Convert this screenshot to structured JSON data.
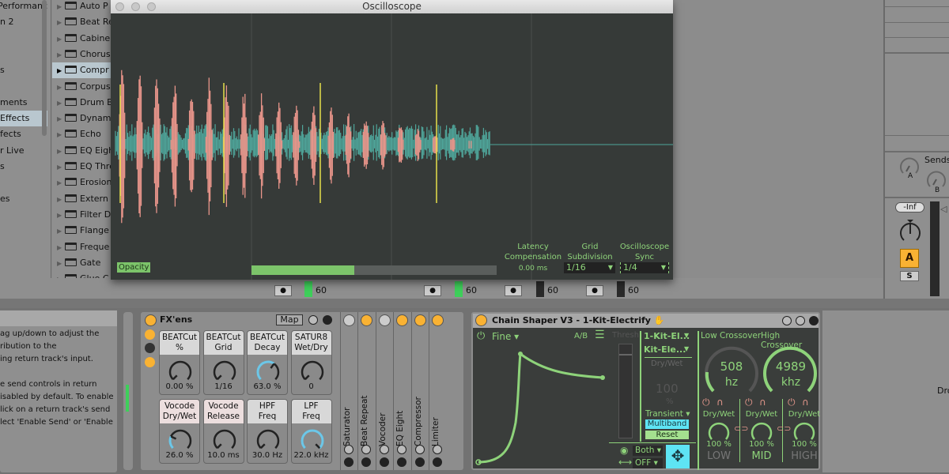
{
  "browser": {
    "categories": [
      {
        "label": "Performanc"
      },
      {
        "label": "n 2"
      },
      {
        "label": ""
      },
      {
        "label": ""
      },
      {
        "label": "s"
      },
      {
        "label": ""
      },
      {
        "label": "ments"
      },
      {
        "label": "Effects",
        "selected": true
      },
      {
        "label": "fects"
      },
      {
        "label": "r Live"
      },
      {
        "label": "s"
      },
      {
        "label": ""
      },
      {
        "label": "es"
      }
    ],
    "items": [
      {
        "label": "Auto P"
      },
      {
        "label": "Beat Re"
      },
      {
        "label": "Cabine"
      },
      {
        "label": "Chorus"
      },
      {
        "label": "Compr",
        "selected": true
      },
      {
        "label": "Corpus"
      },
      {
        "label": "Drum B"
      },
      {
        "label": "Dynam"
      },
      {
        "label": "Echo"
      },
      {
        "label": "EQ Eigh"
      },
      {
        "label": "EQ Thre"
      },
      {
        "label": "Erosion"
      },
      {
        "label": "Extern"
      },
      {
        "label": "Filter D"
      },
      {
        "label": "Flange"
      },
      {
        "label": "Freque"
      },
      {
        "label": "Gate"
      },
      {
        "label": "Glue C"
      }
    ]
  },
  "oscilloscope": {
    "title": "Oscilloscope",
    "opacity_label": "Opacity",
    "opacity_slider": 0.42,
    "latency_label": "Latency Compensation",
    "latency_value": "0.00 ms",
    "grid_label": "Grid Subdivision",
    "grid_value": "1/16",
    "sync_label": "Oscilloscope Sync",
    "sync_value": "1/4",
    "colors": {
      "background": "#363a38",
      "wave_main": "#e8958a",
      "wave_alt": "#4fa59a",
      "marker": "#e6e04a",
      "accent": "#8ed37a"
    }
  },
  "tracks": [
    {
      "level": "60"
    },
    {
      "level": "60"
    },
    {
      "level": "60"
    },
    {
      "level": "60"
    },
    {
      "level": "60"
    }
  ],
  "master": {
    "sends_label": "Sends",
    "send_a": "A",
    "send_b": "B",
    "volume": "-Inf",
    "activator": "A",
    "solo": "S"
  },
  "info_text": [
    "ag up/down to adjust the",
    "ribution to the",
    "ing return track's input.",
    "",
    "e send controls in return",
    "isabled by default. To enable",
    "lick on a return track's send",
    "lect 'Enable Send' or 'Enable"
  ],
  "fxens": {
    "title": "FX'ens",
    "map_label": "Map",
    "macros": [
      {
        "name": "BEATCut %",
        "l1": "BEATCut",
        "l2": "%",
        "value": "0.00 %",
        "pos": 0,
        "pink": false
      },
      {
        "name": "BEATCut Grid",
        "l1": "BEATCut",
        "l2": "Grid",
        "value": "1/16",
        "pos": 0,
        "pink": false
      },
      {
        "name": "BEATCut Decay",
        "l1": "BEATCut",
        "l2": "Decay",
        "value": "63.0 %",
        "pos": 0.63,
        "pink": false
      },
      {
        "name": "SATUR8 Wet/Dry",
        "l1": "SATUR8",
        "l2": "Wet/Dry",
        "value": "0",
        "pos": 0,
        "pink": false
      },
      {
        "name": "Vocode Dry/Wet",
        "l1": "Vocode",
        "l2": "Dry/Wet",
        "value": "26.0 %",
        "pos": 0.26,
        "pink": true
      },
      {
        "name": "Vocode Release",
        "l1": "Vocode",
        "l2": "Release",
        "value": "10.0 ms",
        "pos": 0,
        "pink": true
      },
      {
        "name": "HPF Freq",
        "l1": "HPF",
        "l2": "Freq",
        "value": "30.0 Hz",
        "pos": 0,
        "pink": false
      },
      {
        "name": "LPF Freq",
        "l1": "LPF",
        "l2": "Freq",
        "value": "22.0 kHz",
        "pos": 1,
        "pink": false
      }
    ],
    "chain_devices": [
      {
        "label": "Saturator",
        "on": false
      },
      {
        "label": "Beat Repeat",
        "on": true
      },
      {
        "label": "Vocoder",
        "on": false
      },
      {
        "label": "EQ Eight",
        "on": true
      },
      {
        "label": "Compressor",
        "on": true
      },
      {
        "label": "Limiter",
        "on": true
      }
    ]
  },
  "chain_shaper": {
    "title": "Chain Shaper V3 - 1-Kit-Electrify",
    "mode": "Fine",
    "ab": "A/B",
    "thresh": "Thresh",
    "chain1": "1-Kit-El...",
    "chain2": "Kit-Ele...",
    "drywet_label": "Dry/Wet",
    "drywet_value": "100",
    "drywet_unit": "%",
    "transient": "Transient",
    "multiband": "Multiband",
    "reset": "Reset",
    "view": "Both",
    "link": "OFF",
    "low_crossover_label": "Low Crossover",
    "low_crossover_value": "508",
    "low_crossover_unit": "hz",
    "high_crossover_label": "High Crossover",
    "high_crossover_value": "4989",
    "high_crossover_unit": "khz",
    "bands": [
      {
        "name": "LOW",
        "drywet": "Dry/Wet",
        "value": "100 %",
        "active": false
      },
      {
        "name": "MID",
        "drywet": "Dry/Wet",
        "value": "100 %",
        "active": true
      },
      {
        "name": "HIGH",
        "drywet": "Dry/Wet",
        "value": "100 %",
        "active": false
      }
    ]
  },
  "right_text": "Dro"
}
